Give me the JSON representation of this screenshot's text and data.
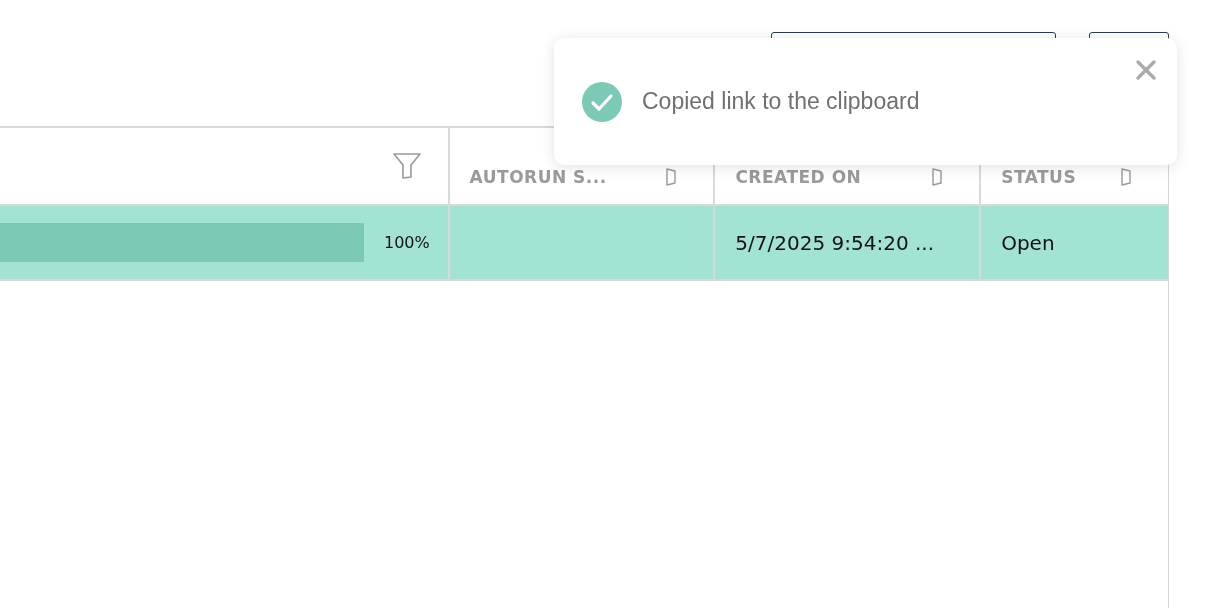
{
  "toolbar": {
    "buttons": [
      {
        "kind": "wide"
      },
      {
        "kind": "narrow"
      }
    ]
  },
  "table": {
    "columns": [
      {
        "kind": "filter"
      },
      {
        "kind": "sort",
        "label": "AUTORUN S..."
      },
      {
        "kind": "sort",
        "label": "CREATED ON"
      },
      {
        "kind": "sort",
        "label": "STATUS"
      }
    ],
    "rows": [
      {
        "selected": true,
        "progress": {
          "reading": "100%"
        },
        "created_on": "5/7/2025 9:54:20 ...",
        "status": "Open"
      }
    ]
  },
  "toast": {
    "kind": "success",
    "message": "Copied link to the clipboard"
  }
}
